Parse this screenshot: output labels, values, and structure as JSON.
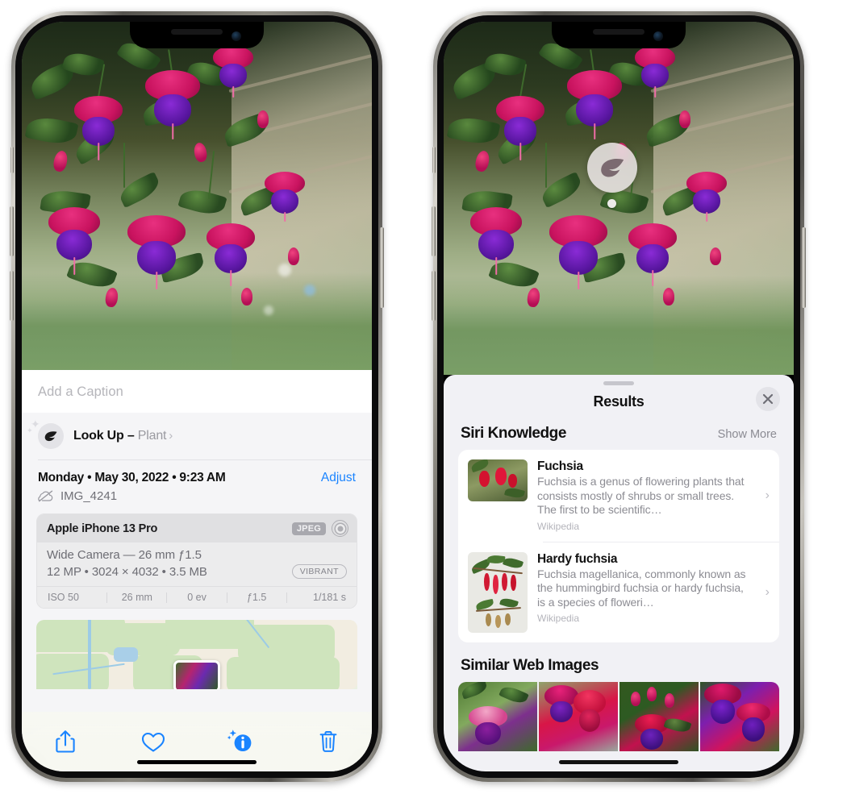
{
  "device": {
    "model_label": "iPhone 13 Pro"
  },
  "left_phone": {
    "caption": {
      "placeholder": "Add a Caption",
      "value": ""
    },
    "lookup": {
      "icon": "leaf-icon",
      "label": "Look Up",
      "dash": " – ",
      "subject": "Plant",
      "chevron": "›"
    },
    "info": {
      "date_line": "Monday • May 30, 2022 • 9:23 AM",
      "adjust_label": "Adjust",
      "cloud_icon": "cloud-slash-icon",
      "file_name": "IMG_4241"
    },
    "exif": {
      "camera_model": "Apple iPhone 13 Pro",
      "format_badge": "JPEG",
      "raw_icon": "aperture-icon",
      "lens_line": "Wide Camera — 26 mm ƒ1.5",
      "size_line": "12 MP • 3024 × 4032 • 3.5 MB",
      "style_badge": "VIBRANT",
      "settings": [
        "ISO 50",
        "26 mm",
        "0 ev",
        "ƒ1.5",
        "1/181 s"
      ]
    },
    "map": {
      "pin_label": "photo-thumbnail-pin"
    },
    "toolbar": [
      {
        "name": "share-button",
        "icon": "share-icon"
      },
      {
        "name": "favorite-button",
        "icon": "heart-icon"
      },
      {
        "name": "info-button",
        "icon": "info-sparkle-icon"
      },
      {
        "name": "delete-button",
        "icon": "trash-icon"
      }
    ]
  },
  "right_phone": {
    "visual_lookup_badge": {
      "icon": "leaf-icon"
    },
    "sheet": {
      "grabber": "drag-handle",
      "title": "Results",
      "close_icon": "close-icon"
    },
    "siri_knowledge": {
      "section_title": "Siri Knowledge",
      "show_more": "Show More",
      "items": [
        {
          "title": "Fuchsia",
          "description": "Fuchsia is a genus of flowering plants that consists mostly of shrubs or small trees. The first to be scientific…",
          "source": "Wikipedia",
          "chevron": "›"
        },
        {
          "title": "Hardy fuchsia",
          "description": "Fuchsia magellanica, commonly known as the hummingbird fuchsia or hardy fuchsia, is a species of floweri…",
          "source": "Wikipedia",
          "chevron": "›"
        }
      ]
    },
    "similar_web_images": {
      "section_title": "Similar Web Images",
      "thumbs": [
        "web-image-1",
        "web-image-2",
        "web-image-3",
        "web-image-4"
      ]
    }
  },
  "colors": {
    "accent_blue": "#1a84ff",
    "sheet_bg": "#f1f1f5",
    "card_white": "#ffffff",
    "secondary_text": "#8c8c93"
  }
}
